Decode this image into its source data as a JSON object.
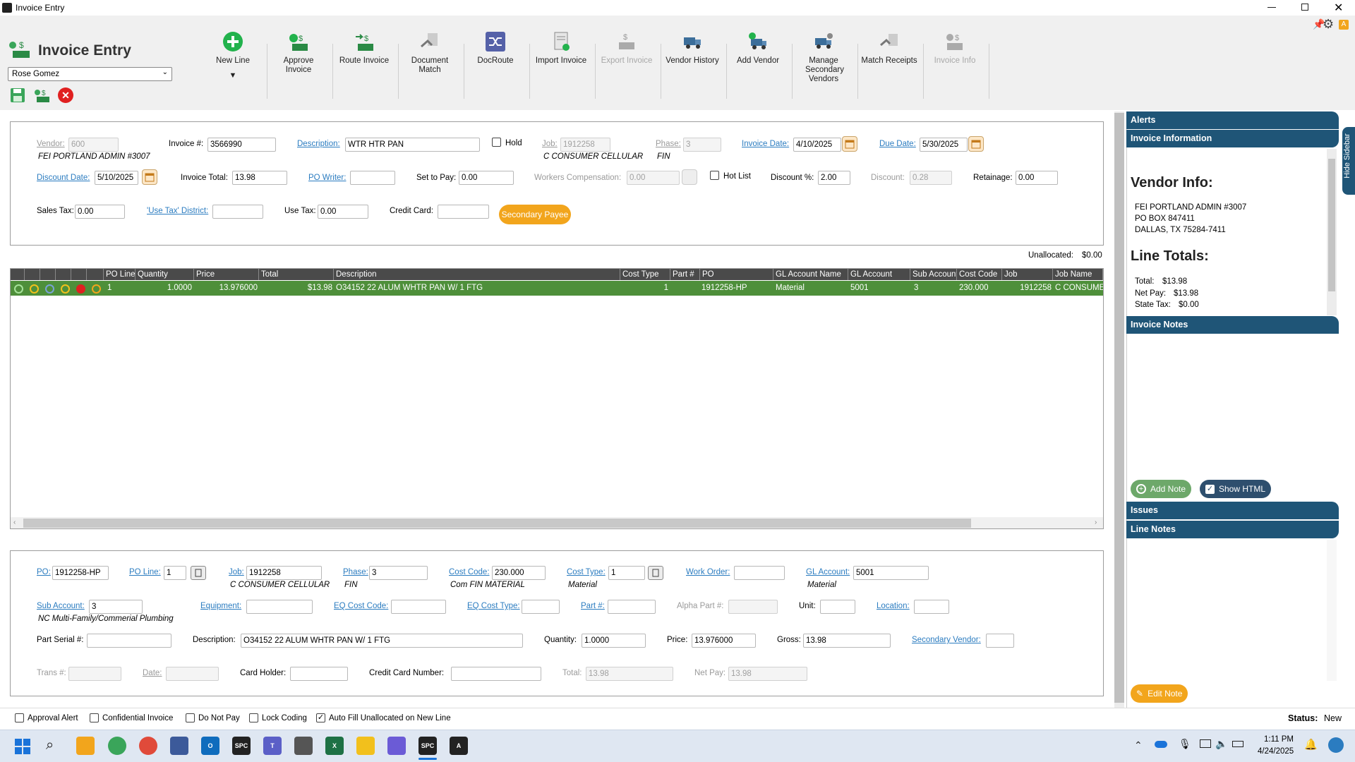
{
  "window": {
    "title": "Invoice Entry"
  },
  "header": {
    "title": "Invoice Entry",
    "user": "Rose Gomez"
  },
  "toolbar": {
    "new_line": "New Line",
    "approve": "Approve Invoice",
    "route": "Route Invoice",
    "document_match": "Document Match",
    "docroute": "DocRoute",
    "import": "Import Invoice",
    "export": "Export Invoice",
    "vendor_history": "Vendor History",
    "add_vendor": "Add Vendor",
    "manage_secondary": "Manage Secondary Vendors",
    "match_receipts": "Match Receipts",
    "invoice_info": "Invoice Info"
  },
  "invoice": {
    "vendor_label": "Vendor:",
    "vendor_value": "600",
    "vendor_name": "FEI PORTLAND ADMIN #3007",
    "invoice_no_label": "Invoice #:",
    "invoice_no": "3566990",
    "description_label": "Description:",
    "description": "WTR HTR PAN",
    "hold_label": "Hold",
    "job_label": "Job:",
    "job": "1912258",
    "job_name": "C CONSUMER CELLULAR",
    "phase_label": "Phase:",
    "phase": "3",
    "phase_name": "FIN",
    "invoice_date_label": "Invoice Date:",
    "invoice_date": "4/10/2025",
    "due_date_label": "Due Date:",
    "due_date": "5/30/2025",
    "discount_date_label": "Discount Date:",
    "discount_date": "5/10/2025",
    "invoice_total_label": "Invoice Total:",
    "invoice_total": "13.98",
    "po_writer_label": "PO Writer:",
    "po_writer": "",
    "set_to_pay_label": "Set to Pay:",
    "set_to_pay": "0.00",
    "workers_comp_label": "Workers Compensation:",
    "workers_comp": "0.00",
    "hot_list_label": "Hot List",
    "discount_pct_label": "Discount %:",
    "discount_pct": "2.00",
    "discount_label": "Discount:",
    "discount": "0.28",
    "retainage_label": "Retainage:",
    "retainage": "0.00",
    "sales_tax_label": "Sales Tax:",
    "sales_tax": "0.00",
    "use_tax_district_label": "'Use Tax' District:",
    "use_tax_district": "",
    "use_tax_label": "Use Tax:",
    "use_tax": "0.00",
    "credit_card_label": "Credit Card:",
    "credit_card": "",
    "secondary_payee": "Secondary Payee",
    "unallocated_label": "Unallocated:",
    "unallocated": "$0.00"
  },
  "grid": {
    "columns": [
      "PO Line",
      "Quantity",
      "Price",
      "Total",
      "Description",
      "Cost Type",
      "Part #",
      "PO",
      "GL Account Name",
      "GL Account",
      "Sub Account",
      "Cost Code",
      "Job",
      "Job Name"
    ],
    "rows": [
      {
        "po_line": "1",
        "quantity": "1.0000",
        "price": "13.976000",
        "total": "$13.98",
        "description": "O34152 22 ALUM WHTR PAN W/ 1 FTG",
        "cost_type": "1",
        "part": "",
        "po": "1912258-HP",
        "gl_account_name": "Material",
        "gl_account": "5001",
        "sub_account": "3",
        "cost_code": "230.000",
        "job": "1912258",
        "job_name": "C CONSUMER CELLULAR"
      }
    ]
  },
  "line": {
    "po_label": "PO:",
    "po": "1912258-HP",
    "po_line_label": "PO Line:",
    "po_line": "1",
    "job_label": "Job:",
    "job": "1912258",
    "job_name": "C CONSUMER CELLULAR",
    "phase_label": "Phase:",
    "phase": "3",
    "phase_name": "FIN",
    "cost_code_label": "Cost Code:",
    "cost_code": "230.000",
    "cost_code_name": "Com FIN MATERIAL",
    "cost_type_label": "Cost Type:",
    "cost_type": "1",
    "cost_type_name": "Material",
    "work_order_label": "Work Order:",
    "work_order": "",
    "gl_account_label": "GL Account:",
    "gl_account": "5001",
    "gl_account_name": "Material",
    "sub_account_label": "Sub Account:",
    "sub_account": "3",
    "sub_account_name": "NC Multi-Family/Commerial Plumbing",
    "equipment_label": "Equipment:",
    "equipment": "",
    "eq_cost_code_label": "EQ Cost Code:",
    "eq_cost_code": "",
    "eq_cost_type_label": "EQ Cost Type:",
    "eq_cost_type": "",
    "part_label": "Part #:",
    "part": "",
    "alpha_part_label": "Alpha Part #:",
    "alpha_part": "",
    "unit_label": "Unit:",
    "unit": "",
    "location_label": "Location:",
    "location": "",
    "part_serial_label": "Part Serial #:",
    "part_serial": "",
    "description_label": "Description:",
    "description": "O34152 22 ALUM WHTR PAN W/ 1 FTG",
    "quantity_label": "Quantity:",
    "quantity": "1.0000",
    "price_label": "Price:",
    "price": "13.976000",
    "gross_label": "Gross:",
    "gross": "13.98",
    "secondary_vendor_label": "Secondary Vendor:",
    "secondary_vendor": "",
    "trans_label": "Trans #:",
    "trans": "",
    "date_label": "Date:",
    "date": "",
    "card_holder_label": "Card Holder:",
    "card_holder": "",
    "cc_number_label": "Credit Card Number:",
    "cc_number": "",
    "total_label": "Total:",
    "total": "13.98",
    "net_pay_label": "Net Pay:",
    "net_pay": "13.98"
  },
  "footer": {
    "approval_alert": "Approval Alert",
    "confidential": "Confidential Invoice",
    "do_not_pay": "Do Not Pay",
    "lock_coding": "Lock Coding",
    "auto_fill": "Auto Fill Unallocated on New Line",
    "status_label": "Status:",
    "status": "New"
  },
  "sidebar": {
    "hide_label": "Hide Sidebar",
    "alerts": "Alerts",
    "invoice_information": "Invoice Information",
    "vendor_info_title": "Vendor Info:",
    "vendor_line1": "FEI PORTLAND ADMIN #3007",
    "vendor_line2": "PO BOX 847411",
    "vendor_line3": "DALLAS, TX 75284-7411",
    "line_totals_title": "Line Totals:",
    "total_label": "Total:",
    "total": "$13.98",
    "net_pay_label": "Net Pay:",
    "net_pay": "$13.98",
    "state_tax_label": "State Tax:",
    "state_tax": "$0.00",
    "invoice_notes": "Invoice Notes",
    "add_note": "Add Note",
    "show_html": "Show HTML",
    "issues": "Issues",
    "line_notes": "Line Notes",
    "edit_note": "Edit Note"
  },
  "taskbar": {
    "time": "1:11 PM",
    "date": "4/24/2025"
  },
  "colors": {
    "grid_row": "#4e8f3a",
    "sidebar_header": "#1f5577",
    "orange": "#f2a51c",
    "link": "#2b7cc0"
  }
}
